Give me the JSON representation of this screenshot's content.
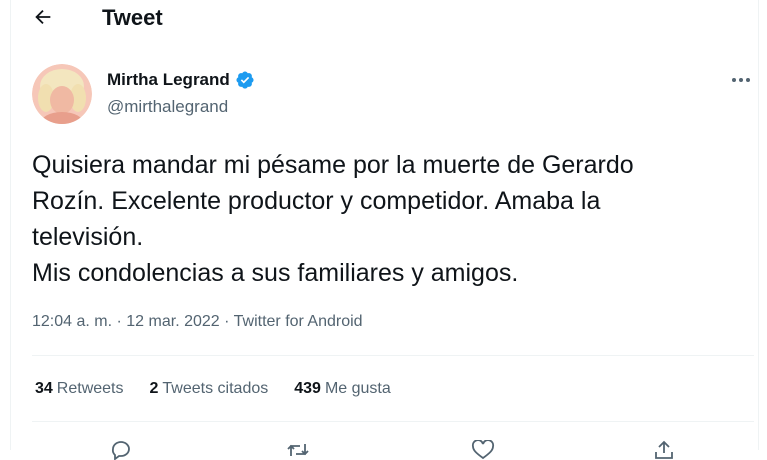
{
  "header": {
    "title": "Tweet",
    "back_icon": "arrow-left-icon"
  },
  "author": {
    "name": "Mirtha Legrand",
    "handle": "@mirthalegrand",
    "verified_icon": "verified-badge-icon",
    "verified_color": "#1d9bf0"
  },
  "tweet": {
    "lines": [
      "Quisiera mandar mi pésame por la muerte de Gerardo",
      "Rozín. Excelente productor y competidor. Amaba la",
      "televisión.",
      "Mis condolencias a sus familiares y amigos."
    ],
    "time": "12:04 a. m.",
    "separator": "·",
    "date": "12 mar. 2022",
    "source": "Twitter for Android"
  },
  "stats": {
    "retweets": {
      "count": "34",
      "label": "Retweets"
    },
    "quotes": {
      "count": "2",
      "label": "Tweets citados"
    },
    "likes": {
      "count": "439",
      "label": "Me gusta"
    }
  },
  "actions": [
    "reply-icon",
    "retweet-icon",
    "like-icon",
    "share-icon"
  ],
  "colors": {
    "text": "#0f1419",
    "secondary": "#536471",
    "divider": "#eff3f4",
    "accent": "#1d9bf0"
  }
}
